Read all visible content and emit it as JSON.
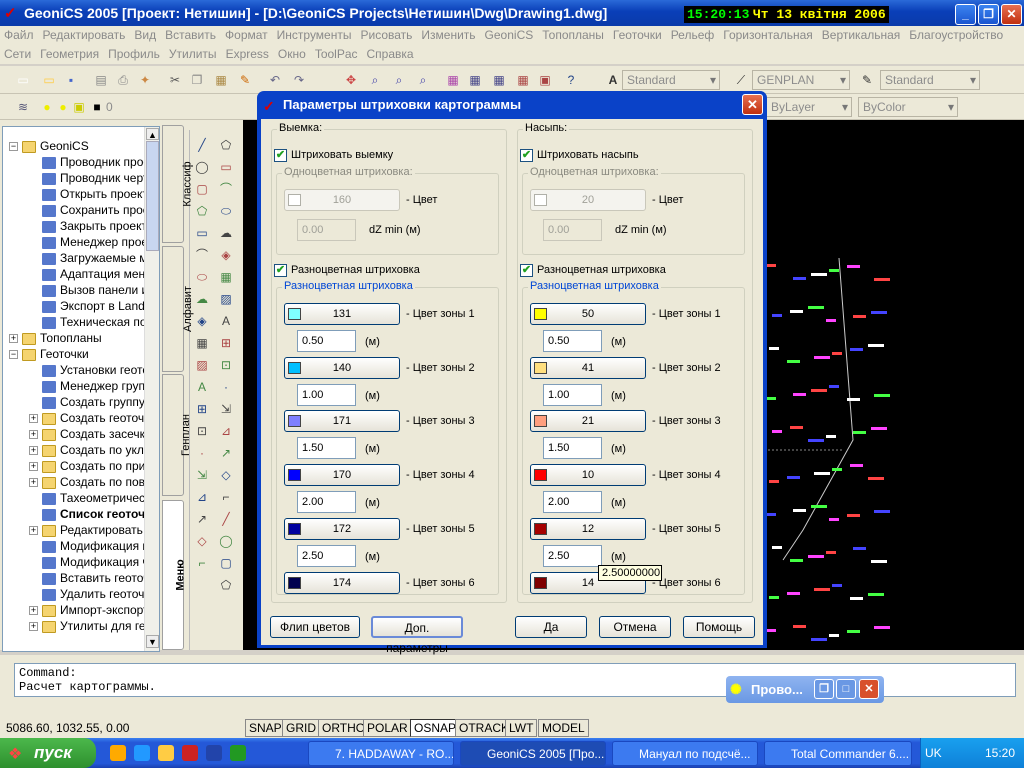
{
  "window": {
    "title": "GeoniCS 2005 [Проект: Нетишин] - [D:\\GeoniCS Projects\\Нетишин\\Dwg\\Drawing1.dwg]",
    "time": "15:20:13",
    "date": "Чт 13 квітня 2006"
  },
  "menu1": [
    "Файл",
    "Редактировать",
    "Вид",
    "Вставить",
    "Формат",
    "Инструменты",
    "Рисовать",
    "Изменить",
    "GeoniCS",
    "Топопланы",
    "Геоточки",
    "Рельеф",
    "Горизонтальная",
    "Вертикальная",
    "Благоустройство"
  ],
  "menu2": [
    "Сети",
    "Геометрия",
    "Профиль",
    "Утилиты",
    "Express",
    "Окно",
    "ToolPac",
    "Справка"
  ],
  "toolbar": {
    "textstyle": "Standard",
    "dimstyle": "GENPLAN",
    "tablestyle": "Standard",
    "layer_num": "0",
    "linetype": "ByLayer",
    "color": "ByColor"
  },
  "tree": [
    {
      "label": "GeoniCS",
      "lvl": 0,
      "pm": "−",
      "icon": "folder"
    },
    {
      "label": "Проводник проекта",
      "lvl": 1,
      "icon": "tool"
    },
    {
      "label": "Проводник чертежей",
      "lvl": 1,
      "icon": "tool"
    },
    {
      "label": "Открыть проект",
      "lvl": 1,
      "icon": "tool"
    },
    {
      "label": "Сохранить проект",
      "lvl": 1,
      "icon": "tool"
    },
    {
      "label": "Закрыть проект",
      "lvl": 1,
      "icon": "tool"
    },
    {
      "label": "Менеджер проектов",
      "lvl": 1,
      "icon": "tool"
    },
    {
      "label": "Загружаемые модули",
      "lvl": 1,
      "icon": "tool"
    },
    {
      "label": "Адаптация меню",
      "lvl": 1,
      "icon": "tool"
    },
    {
      "label": "Вызов панели инструментов",
      "lvl": 1,
      "icon": "tool"
    },
    {
      "label": "Экспорт в Land",
      "lvl": 1,
      "icon": "tool"
    },
    {
      "label": "Техническая поддержка",
      "lvl": 1,
      "icon": "tool"
    },
    {
      "label": "Топопланы",
      "lvl": 0,
      "pm": "+",
      "icon": "folder"
    },
    {
      "label": "Геоточки",
      "lvl": 0,
      "pm": "−",
      "icon": "folder"
    },
    {
      "label": "Установки геоточек",
      "lvl": 1,
      "icon": "tool"
    },
    {
      "label": "Менеджер групп",
      "lvl": 1,
      "icon": "tool"
    },
    {
      "label": "Создать группу",
      "lvl": 1,
      "icon": "tool"
    },
    {
      "label": "Создать геоточки",
      "lvl": 1,
      "pm": "+",
      "icon": "folder"
    },
    {
      "label": "Создать засечки",
      "lvl": 1,
      "pm": "+",
      "icon": "folder"
    },
    {
      "label": "Создать по уклону",
      "lvl": 1,
      "pm": "+",
      "icon": "folder"
    },
    {
      "label": "Создать по привязке",
      "lvl": 1,
      "pm": "+",
      "icon": "folder"
    },
    {
      "label": "Создать по поверхности",
      "lvl": 1,
      "pm": "+",
      "icon": "folder"
    },
    {
      "label": "Тахеометрический журнал",
      "lvl": 1,
      "icon": "tool"
    },
    {
      "label": "Список геоточек",
      "lvl": 1,
      "icon": "tool",
      "bold": true
    },
    {
      "label": "Редактировать",
      "lvl": 1,
      "pm": "+",
      "icon": "folder"
    },
    {
      "label": "Модификация геоточек",
      "lvl": 1,
      "icon": "tool"
    },
    {
      "label": "Модификация чертежа",
      "lvl": 1,
      "icon": "tool"
    },
    {
      "label": "Вставить геоточки",
      "lvl": 1,
      "icon": "tool"
    },
    {
      "label": "Удалить геоточки",
      "lvl": 1,
      "icon": "tool"
    },
    {
      "label": "Импорт-экспорт",
      "lvl": 1,
      "pm": "+",
      "icon": "folder"
    },
    {
      "label": "Утилиты для геоточек",
      "lvl": 1,
      "pm": "+",
      "icon": "folder"
    }
  ],
  "vtabs": [
    "Классиф",
    "Алфавит",
    "Генплан",
    "Меню"
  ],
  "command": {
    "line1": "Command:",
    "line2": "Расчет картограммы."
  },
  "status": {
    "coords": "5086.60, 1032.55, 0.00",
    "buttons": [
      "SNAP",
      "GRID",
      "ORTHO",
      "POLAR",
      "OSNAP",
      "OTRACK",
      "LWT",
      "MODEL"
    ]
  },
  "taskbar": {
    "start": "пуск",
    "tasks": [
      "7. HADDAWAY - RO...",
      "GeoniCS 2005 [Про...",
      "Мануал по подсчё...",
      "Total Commander 6...."
    ],
    "lang": "UK",
    "clock": "15:20"
  },
  "floatwin": {
    "title": "Прово..."
  },
  "dialog": {
    "title": "Параметры штриховки картограммы",
    "tooltip": "2.50000000",
    "left": {
      "group": "Выемка:",
      "check": "Штриховать выемку",
      "mono_title": "Одноцветная штриховка:",
      "mono_val": "160",
      "mono_swatch": "#ffffff",
      "dz_val": "0.00",
      "dz_lbl": "dZ min (м)",
      "multi_check": "Разноцветная штриховка",
      "multi_title": "Разноцветная штриховка",
      "zones": [
        {
          "val": "131",
          "swatch": "#7fffff",
          "h": "0.50"
        },
        {
          "val": "140",
          "swatch": "#00bfff",
          "h": "1.00"
        },
        {
          "val": "171",
          "swatch": "#7f7fff",
          "h": "1.50"
        },
        {
          "val": "170",
          "swatch": "#0000ff",
          "h": "2.00"
        },
        {
          "val": "172",
          "swatch": "#00009f",
          "h": "2.50"
        },
        {
          "val": "174",
          "swatch": "#00004f"
        }
      ]
    },
    "right": {
      "group": "Насыпь:",
      "check": "Штриховать насыпь",
      "mono_title": "Одноцветная штриховка:",
      "mono_val": "20",
      "mono_swatch": "#ffffff",
      "dz_val": "0.00",
      "dz_lbl": "dZ min (м)",
      "multi_check": "Разноцветная штриховка",
      "multi_title": "Разноцветная штриховка",
      "zones": [
        {
          "val": "50",
          "swatch": "#ffff00",
          "h": "0.50"
        },
        {
          "val": "41",
          "swatch": "#ffdf7f",
          "h": "1.00"
        },
        {
          "val": "21",
          "swatch": "#ff9f7f",
          "h": "1.50"
        },
        {
          "val": "10",
          "swatch": "#ff0000",
          "h": "2.00"
        },
        {
          "val": "12",
          "swatch": "#a50000",
          "h": "2.50"
        },
        {
          "val": "14",
          "swatch": "#7f0000"
        }
      ]
    },
    "color_lbl": "- Цвет",
    "zone_lbls": [
      "- Цвет зоны 1",
      "- Цвет зоны 2",
      "- Цвет зоны 3",
      "- Цвет зоны 4",
      "- Цвет зоны 5",
      "- Цвет зоны 6"
    ],
    "unit": "(м)",
    "buttons": {
      "flip": "Флип цветов",
      "extra": "Доп. параметры",
      "ok": "Да",
      "cancel": "Отмена",
      "help": "Помощь"
    }
  }
}
